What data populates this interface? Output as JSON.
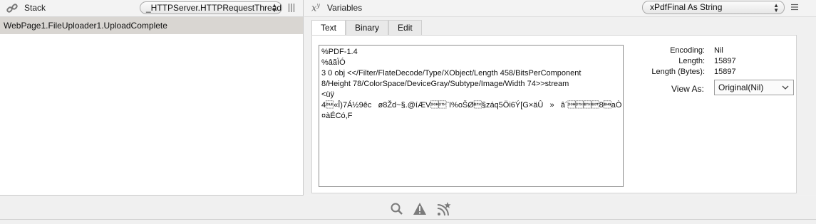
{
  "stack_panel": {
    "title": "Stack",
    "thread_select": "_HTTPServer.HTTPRequestThread",
    "rows": [
      "WebPage1.FileUploader1.UploadComplete"
    ]
  },
  "variables_panel": {
    "title": "Variables",
    "variable_select": "xPdfFinal As String",
    "tabs": [
      "Text",
      "Binary",
      "Edit"
    ],
    "active_tab": "Text",
    "text_content": "%PDF-1.4\n%âãÏÓ\n3 0 obj <</Filter/FlateDecode/Type/XObject/Length 458/BitsPerComponent\n8/Height 78/ColorSpace/DeviceGray/Subtype/Image/Width 74>>stream\n<üÿ\n4\u0010«Î)7Á½9êc   ø8Žd~§.@íÆV\u0001\u0002¨I%oŠØ\u0003§záq5Öi6Ý[G×äÛ   »   â´\u0001\u0002\u0003\u00048\u0005aÒ\n¤àÉCó,F",
    "info": {
      "encoding_label": "Encoding:",
      "encoding_value": "Nil",
      "length_label": "Length:",
      "length_value": "15897",
      "length_bytes_label": "Length (Bytes):",
      "length_bytes_value": "15897",
      "view_as_label": "View As:",
      "view_as_value": "Original(Nil)"
    }
  },
  "bottom_toolbar": {
    "icons": [
      "search-icon",
      "warning-icon",
      "feed-star-icon"
    ]
  }
}
